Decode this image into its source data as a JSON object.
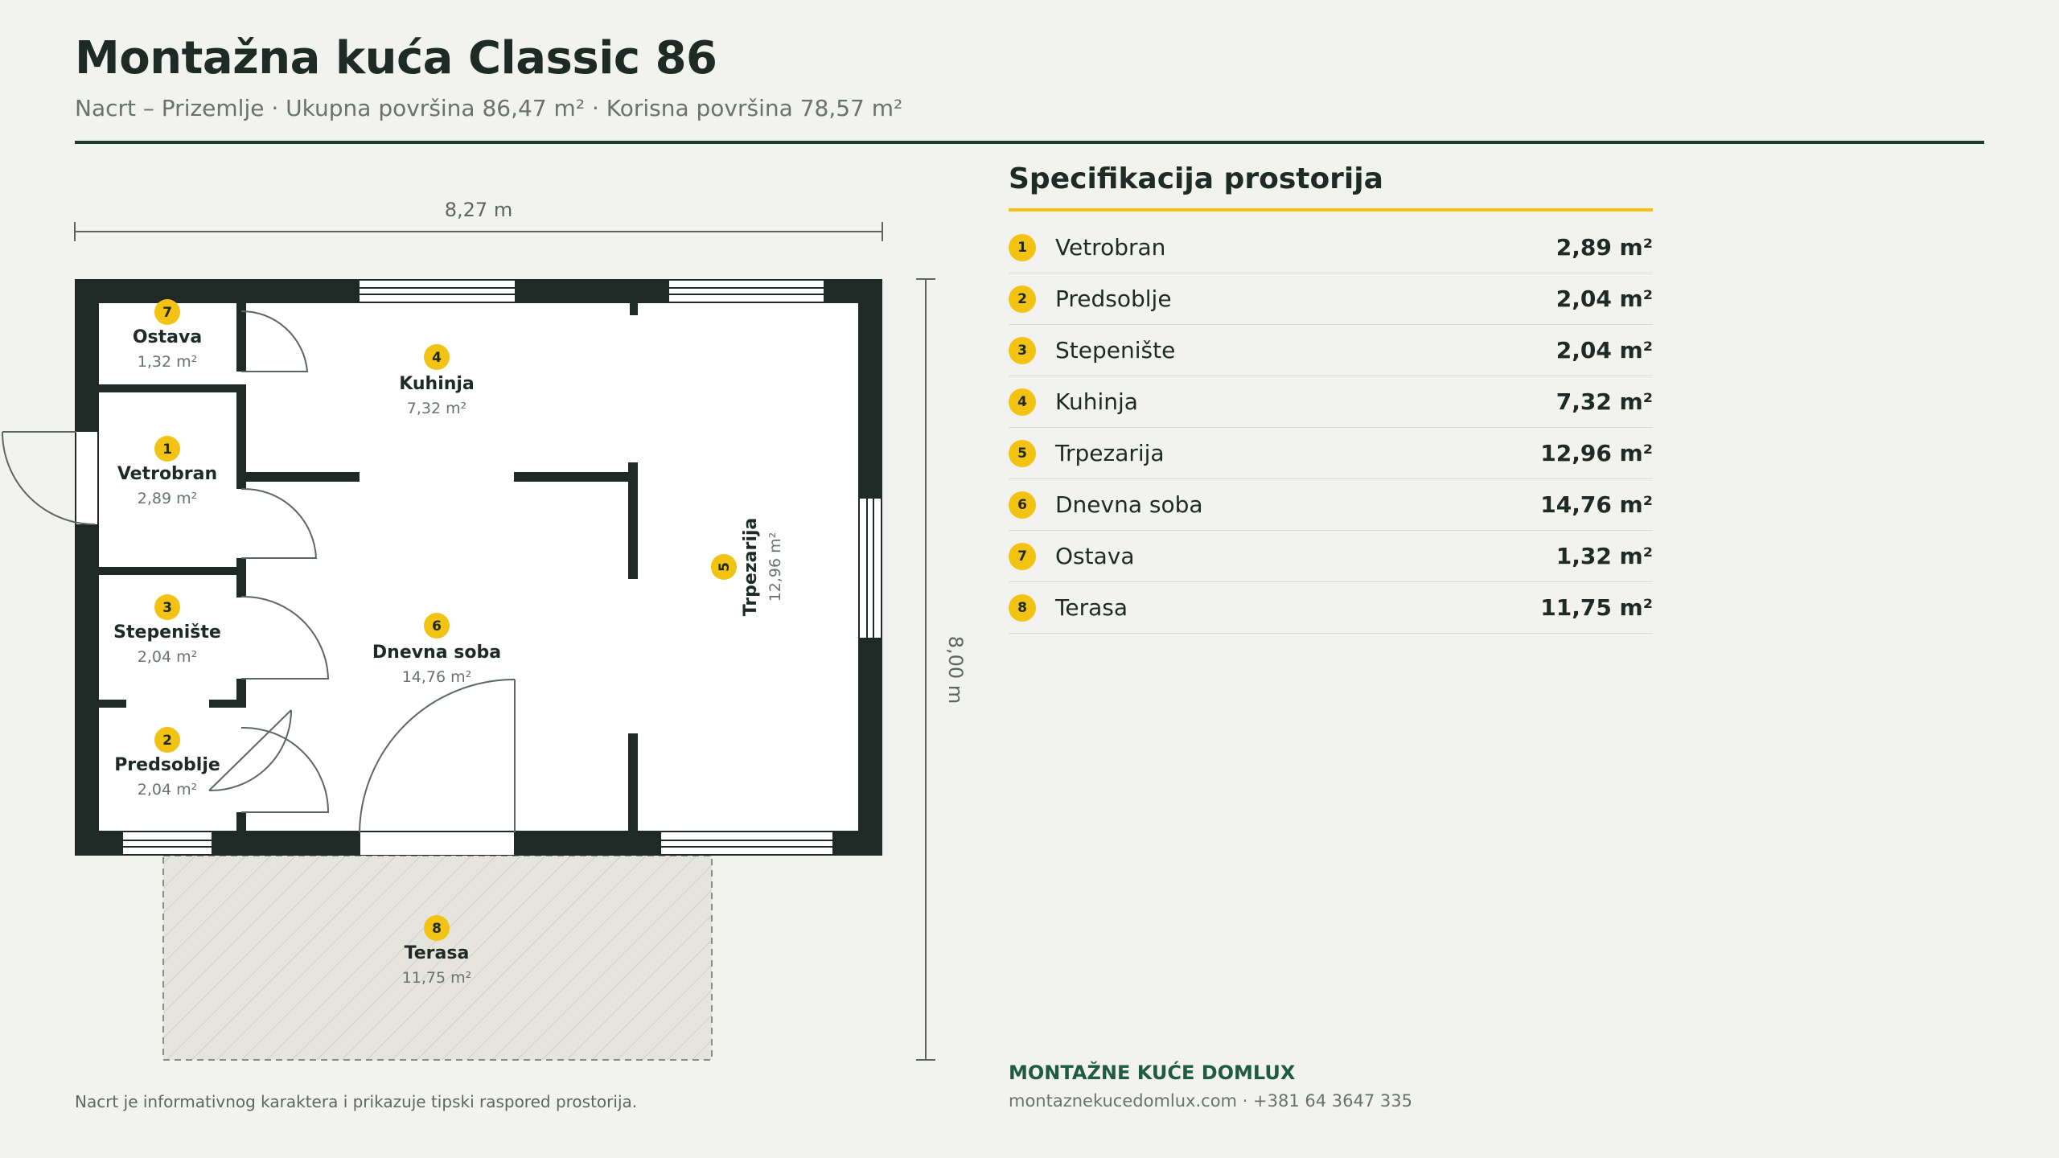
{
  "header": {
    "title": "Montažna kuća Classic 86",
    "subtitle": "Nacrt – Prizemlje · Ukupna površina 86,47 m² · Korisna površina 78,57 m²"
  },
  "plan": {
    "width_label": "8,27 m",
    "depth_label": "8,00 m",
    "rooms": [
      {
        "num": "1",
        "name": "Vetrobran",
        "area": "2,89 m²"
      },
      {
        "num": "2",
        "name": "Predsoblje",
        "area": "2,04 m²"
      },
      {
        "num": "3",
        "name": "Stepenište",
        "area": "2,04 m²"
      },
      {
        "num": "4",
        "name": "Kuhinja",
        "area": "7,32 m²"
      },
      {
        "num": "5",
        "name": "Trpezarija",
        "area": "12,96 m²"
      },
      {
        "num": "6",
        "name": "Dnevna soba",
        "area": "14,76 m²"
      },
      {
        "num": "7",
        "name": "Ostava",
        "area": "1,32 m²"
      },
      {
        "num": "8",
        "name": "Terasa",
        "area": "11,75 m²"
      }
    ]
  },
  "spec": {
    "title": "Specifikacija prostorija",
    "rows": [
      {
        "num": "1",
        "name": "Vetrobran",
        "area": "2,89 m²"
      },
      {
        "num": "2",
        "name": "Predsoblje",
        "area": "2,04 m²"
      },
      {
        "num": "3",
        "name": "Stepenište",
        "area": "2,04 m²"
      },
      {
        "num": "4",
        "name": "Kuhinja",
        "area": "7,32 m²"
      },
      {
        "num": "5",
        "name": "Trpezarija",
        "area": "12,96 m²"
      },
      {
        "num": "6",
        "name": "Dnevna soba",
        "area": "14,76 m²"
      },
      {
        "num": "7",
        "name": "Ostava",
        "area": "1,32 m²"
      },
      {
        "num": "8",
        "name": "Terasa",
        "area": "11,75 m²"
      }
    ]
  },
  "footer": {
    "brand": "MONTAŽNE KUĆE DOMLUX",
    "contact": "montaznekucedomlux.com · +381 64 3647 335",
    "note": "Nacrt je informativnog karaktera i prikazuje tipski raspored prostorija."
  },
  "colors": {
    "wall": "#1f2a26",
    "accent": "#f2c313",
    "brand": "#1f5a45",
    "background": "#f2f2ee"
  }
}
